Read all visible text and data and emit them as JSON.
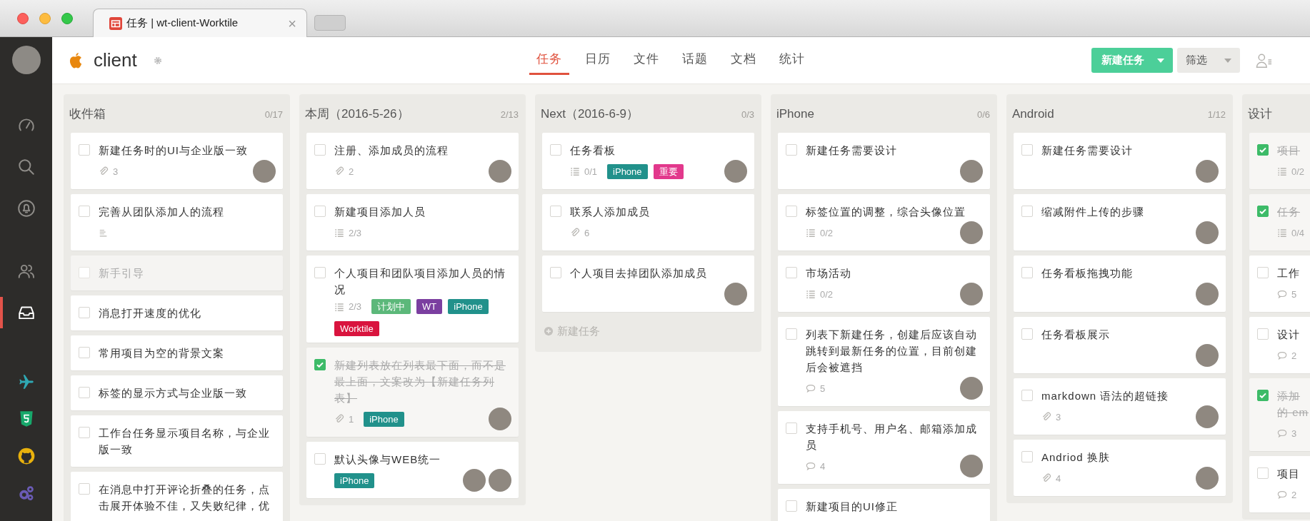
{
  "browser": {
    "tab": {
      "title": "任务 | wt-client-Worktile",
      "close": "×"
    }
  },
  "sidebar": {
    "sections": [
      {
        "items": [
          {
            "kind": "dashboard",
            "selected": false
          },
          {
            "kind": "search",
            "selected": false
          },
          {
            "kind": "notifications",
            "selected": false
          }
        ]
      },
      {
        "items": [
          {
            "kind": "members",
            "selected": false
          },
          {
            "kind": "inbox",
            "selected": true
          }
        ]
      },
      {
        "items": [
          {
            "kind": "plane",
            "color": "#2fa8b3",
            "selected": false
          },
          {
            "kind": "shield",
            "color": "#17a86b",
            "selected": false
          },
          {
            "kind": "cat",
            "color": "#e8b10d",
            "selected": false
          },
          {
            "kind": "gears",
            "color": "#6a5bb5",
            "selected": false
          }
        ]
      }
    ]
  },
  "header": {
    "project": "client",
    "tabs": [
      {
        "label": "任务",
        "selected": true
      },
      {
        "label": "日历",
        "selected": false
      },
      {
        "label": "文件",
        "selected": false
      },
      {
        "label": "话题",
        "selected": false
      },
      {
        "label": "文档",
        "selected": false
      },
      {
        "label": "统计",
        "selected": false
      }
    ],
    "new_task_button": "新建任务",
    "filter_button": "筛选"
  },
  "columns": [
    {
      "title": "收件箱",
      "count": "0/17",
      "cards": [
        {
          "title": "新建任务时的UI与企业版一致",
          "checked": false,
          "muted": false,
          "meta": [
            {
              "kind": "attachment",
              "text": "3"
            }
          ],
          "avatars": [
            {
              "kind": "photo"
            }
          ]
        },
        {
          "title": "完善从团队添加人的流程",
          "checked": false,
          "muted": false,
          "meta": [
            {
              "kind": "description"
            }
          ]
        },
        {
          "title": "新手引导",
          "checked": false,
          "muted": true
        },
        {
          "title": "消息打开速度的优化",
          "checked": false,
          "muted": false
        },
        {
          "title": "常用项目为空的背景文案",
          "checked": false,
          "muted": false
        },
        {
          "title": "标签的显示方式与企业版一致",
          "checked": false,
          "muted": false
        },
        {
          "title": "工作台任务显示项目名称，与企业版一致",
          "checked": false,
          "muted": false
        },
        {
          "title": "在消息中打开评论折叠的任务，点击展开体验不佳，又失败纪律，优",
          "checked": false,
          "muted": false
        }
      ]
    },
    {
      "title": "本周（2016-5-26）",
      "count": "2/13",
      "cards": [
        {
          "title": "注册、添加成员的流程",
          "checked": false,
          "muted": false,
          "meta": [
            {
              "kind": "attachment",
              "text": "2"
            }
          ],
          "avatars": [
            {
              "kind": "photo"
            }
          ]
        },
        {
          "title": "新建项目添加人员",
          "checked": false,
          "muted": false,
          "meta": [
            {
              "kind": "checklist",
              "text": "2/3"
            }
          ]
        },
        {
          "title": "个人项目和团队项目添加人员的情况",
          "checked": false,
          "muted": false,
          "meta": [
            {
              "kind": "checklist",
              "text": "2/3"
            }
          ],
          "tags": [
            {
              "text": "计划中",
              "color": "#5cb87a"
            },
            {
              "text": "WT",
              "color": "#7b3fa0"
            },
            {
              "text": "iPhone",
              "color": "#21918b"
            },
            {
              "text": "Worktile",
              "color": "#d9143e"
            }
          ]
        },
        {
          "title": "新建列表放在列表最下面，而不是最上面，文案改为【新建任务列表】",
          "checked": true,
          "muted": false,
          "meta": [
            {
              "kind": "attachment",
              "text": "1"
            }
          ],
          "tags": [
            {
              "text": "iPhone",
              "color": "#21918b"
            }
          ],
          "avatars": [
            {
              "kind": "photo"
            }
          ]
        },
        {
          "title": "默认头像与WEB统一",
          "checked": false,
          "muted": false,
          "tags": [
            {
              "text": "iPhone",
              "color": "#21918b"
            }
          ],
          "avatars": [
            {
              "kind": "photo"
            },
            {
              "kind": "photo"
            }
          ]
        }
      ]
    },
    {
      "title": "Next（2016-6-9）",
      "count": "0/3",
      "add_task": "新建任务",
      "cards": [
        {
          "title": "任务看板",
          "checked": false,
          "muted": false,
          "meta": [
            {
              "kind": "checklist",
              "text": "0/1"
            }
          ],
          "tags": [
            {
              "text": "iPhone",
              "color": "#21918b"
            },
            {
              "text": "重要",
              "color": "#e2388c"
            }
          ],
          "avatars": [
            {
              "kind": "photo"
            }
          ]
        },
        {
          "title": "联系人添加成员",
          "checked": false,
          "muted": false,
          "meta": [
            {
              "kind": "attachment",
              "text": "6"
            }
          ]
        },
        {
          "title": "个人项目去掉团队添加成员",
          "checked": false,
          "muted": false,
          "avatars": [
            {
              "kind": "photo"
            }
          ]
        }
      ]
    },
    {
      "title": "iPhone",
      "count": "0/6",
      "cards": [
        {
          "title": "新建任务需要设计",
          "checked": false,
          "muted": false,
          "avatars": [
            {
              "kind": "photo"
            }
          ]
        },
        {
          "title": "标签位置的调整，综合头像位置",
          "checked": false,
          "muted": false,
          "meta": [
            {
              "kind": "checklist",
              "text": "0/2"
            }
          ],
          "avatars": [
            {
              "kind": "photo"
            }
          ]
        },
        {
          "title": "市场活动",
          "checked": false,
          "muted": false,
          "meta": [
            {
              "kind": "checklist",
              "text": "0/2"
            }
          ],
          "avatars": [
            {
              "kind": "photo"
            }
          ]
        },
        {
          "title": "列表下新建任务，创建后应该自动跳转到最新任务的位置，目前创建后会被遮挡",
          "checked": false,
          "muted": false,
          "meta": [
            {
              "kind": "comment",
              "text": "5"
            }
          ],
          "avatars": [
            {
              "kind": "photo"
            }
          ]
        },
        {
          "title": "支持手机号、用户名、邮箱添加成员",
          "checked": false,
          "muted": false,
          "meta": [
            {
              "kind": "comment",
              "text": "4"
            }
          ],
          "avatars": [
            {
              "kind": "photo"
            }
          ]
        },
        {
          "title": "新建项目的UI修正",
          "checked": false,
          "muted": false
        }
      ]
    },
    {
      "title": "Android",
      "count": "1/12",
      "cards": [
        {
          "title": "新建任务需要设计",
          "checked": false,
          "muted": false,
          "avatars": [
            {
              "kind": "photo"
            }
          ]
        },
        {
          "title": "缩减附件上传的步骤",
          "checked": false,
          "muted": false,
          "avatars": [
            {
              "kind": "photo"
            }
          ]
        },
        {
          "title": "任务看板拖拽功能",
          "checked": false,
          "muted": false,
          "avatars": [
            {
              "kind": "photo"
            }
          ]
        },
        {
          "title": "任务看板展示",
          "checked": false,
          "muted": false,
          "avatars": [
            {
              "kind": "photo"
            }
          ]
        },
        {
          "title": "markdown 语法的超链接",
          "checked": false,
          "muted": false,
          "meta": [
            {
              "kind": "attachment",
              "text": "3"
            }
          ],
          "avatars": [
            {
              "kind": "photo"
            }
          ]
        },
        {
          "title": "Andriod 换肤",
          "checked": false,
          "muted": false,
          "meta": [
            {
              "kind": "attachment",
              "text": "4"
            }
          ],
          "avatars": [
            {
              "kind": "photo"
            }
          ]
        }
      ]
    },
    {
      "title": "设计",
      "cards": [
        {
          "title": "项目",
          "checked": true,
          "muted": false,
          "meta": [
            {
              "kind": "checklist",
              "text": "0/2"
            }
          ]
        },
        {
          "title": "任务",
          "checked": true,
          "muted": false,
          "meta": [
            {
              "kind": "checklist",
              "text": "0/4"
            }
          ]
        },
        {
          "title": "工作",
          "checked": false,
          "muted": false,
          "meta": [
            {
              "kind": "comment",
              "text": "5"
            }
          ]
        },
        {
          "title": "设计",
          "checked": false,
          "muted": false,
          "meta": [
            {
              "kind": "comment",
              "text": "2"
            }
          ]
        },
        {
          "title": "添加",
          "title_cont": "的 em",
          "checked": true,
          "muted": false,
          "meta": [
            {
              "kind": "comment",
              "text": "3"
            }
          ]
        },
        {
          "title": "项目",
          "checked": false,
          "muted": false,
          "meta": [
            {
              "kind": "comment",
              "text": "2"
            }
          ]
        }
      ]
    }
  ]
}
